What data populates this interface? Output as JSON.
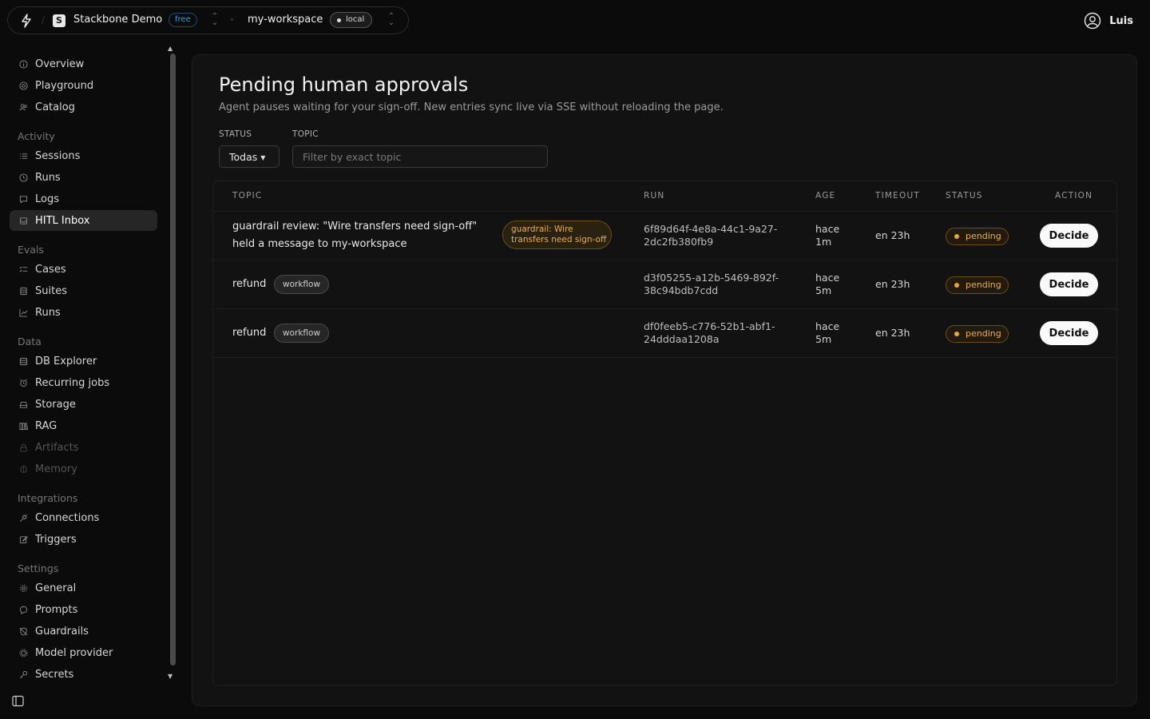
{
  "topbar": {
    "org_logo_letter": "S",
    "org_name": "Stackbone Demo",
    "plan": "free",
    "workspace": "my-workspace",
    "environment": "local",
    "user": "Luis"
  },
  "sidebar": {
    "top_items": [
      {
        "label": "Overview",
        "icon": "info-icon"
      },
      {
        "label": "Playground",
        "icon": "target-icon"
      },
      {
        "label": "Catalog",
        "icon": "users-icon"
      }
    ],
    "sections": [
      {
        "title": "Activity",
        "items": [
          {
            "label": "Sessions",
            "icon": "list-icon"
          },
          {
            "label": "Runs",
            "icon": "clock-icon"
          },
          {
            "label": "Logs",
            "icon": "message-icon"
          },
          {
            "label": "HITL Inbox",
            "icon": "inbox-icon",
            "active": true
          }
        ]
      },
      {
        "title": "Evals",
        "items": [
          {
            "label": "Cases",
            "icon": "checklist-icon"
          },
          {
            "label": "Suites",
            "icon": "layers-icon"
          },
          {
            "label": "Runs",
            "icon": "chart-icon"
          }
        ]
      },
      {
        "title": "Data",
        "items": [
          {
            "label": "DB Explorer",
            "icon": "database-icon"
          },
          {
            "label": "Recurring jobs",
            "icon": "alarm-icon"
          },
          {
            "label": "Storage",
            "icon": "drive-icon"
          },
          {
            "label": "RAG",
            "icon": "books-icon"
          },
          {
            "label": "Artifacts",
            "icon": "lock-icon",
            "disabled": true
          },
          {
            "label": "Memory",
            "icon": "brain-icon",
            "disabled": true
          }
        ]
      },
      {
        "title": "Integrations",
        "items": [
          {
            "label": "Connections",
            "icon": "plug-icon"
          },
          {
            "label": "Triggers",
            "icon": "edit-icon"
          }
        ]
      },
      {
        "title": "Settings",
        "items": [
          {
            "label": "General",
            "icon": "gear-icon"
          },
          {
            "label": "Prompts",
            "icon": "chat-icon"
          },
          {
            "label": "Guardrails",
            "icon": "shield-off-icon"
          },
          {
            "label": "Model provider",
            "icon": "cpu-icon"
          },
          {
            "label": "Secrets",
            "icon": "key-icon"
          }
        ]
      }
    ]
  },
  "main": {
    "title": "Pending human approvals",
    "subtitle": "Agent pauses waiting for your sign-off. New entries sync live via SSE without reloading the page.",
    "filters": {
      "status_label": "STATUS",
      "status_value": "Todas",
      "topic_label": "TOPIC",
      "topic_placeholder": "Filter by exact topic",
      "topic_value": ""
    },
    "table": {
      "headers": [
        "TOPIC",
        "RUN",
        "AGE",
        "TIMEOUT",
        "STATUS",
        "ACTION"
      ],
      "rows": [
        {
          "topic_line1": "guardrail review: \"Wire transfers need sign-off\"",
          "topic_line2": "held a message to my-workspace",
          "tag_line1": "guardrail: Wire",
          "tag_line2": "transfers need sign-off",
          "run_line1": "6f89d64f-4e8a-44c1-9a27-",
          "run_line2": "2dc2fb380fb9",
          "age_line1": "hace",
          "age_line2": "1m",
          "timeout": "en 23h",
          "status": "pending",
          "action": "Decide"
        },
        {
          "topic": "refund",
          "tag": "workflow",
          "run_line1": "d3f05255-a12b-5469-892f-",
          "run_line2": "38c94bdb7cdd",
          "age_line1": "hace",
          "age_line2": "5m",
          "timeout": "en 23h",
          "status": "pending",
          "action": "Decide"
        },
        {
          "topic": "refund",
          "tag": "workflow",
          "run_line1": "df0feeb5-c776-52b1-abf1-",
          "run_line2": "24dddaa1208a",
          "age_line1": "hace",
          "age_line2": "5m",
          "timeout": "en 23h",
          "status": "pending",
          "action": "Decide"
        }
      ]
    }
  },
  "colors": {
    "accent_pending": "#e7b24a",
    "plan_badge": "#3b9ad6",
    "active_nav_bg": "#262626"
  }
}
